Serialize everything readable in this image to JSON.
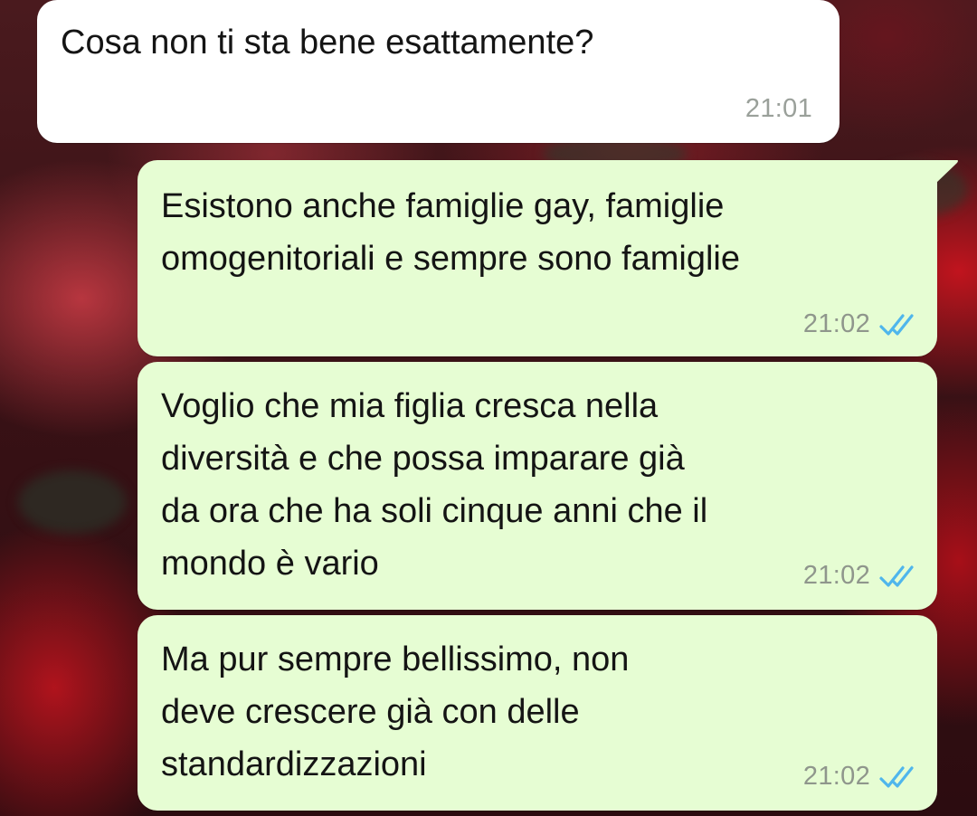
{
  "colors": {
    "incoming_bubble": "#ffffff",
    "outgoing_bubble": "#e6fdd3",
    "read_ticks": "#4fb6ec",
    "timestamp": "#8f968c"
  },
  "messages": [
    {
      "direction": "incoming",
      "text": "Cosa non ti sta bene esattamente?",
      "time": "21:01"
    },
    {
      "direction": "outgoing",
      "text": "Esistono anche famiglie gay, famiglie\nomogenitoriali e sempre sono famiglie",
      "time": "21:02",
      "status_icon": "double-check-read-icon"
    },
    {
      "direction": "outgoing",
      "text": "Voglio che mia figlia cresca nella\ndiversità e che possa imparare già\nda ora che ha soli cinque anni che il\nmondo è vario",
      "time": "21:02",
      "status_icon": "double-check-read-icon"
    },
    {
      "direction": "outgoing",
      "text": "Ma pur sempre bellissimo, non\ndeve crescere già con delle\nstandardizzazioni",
      "time": "21:02",
      "status_icon": "double-check-read-icon"
    }
  ]
}
